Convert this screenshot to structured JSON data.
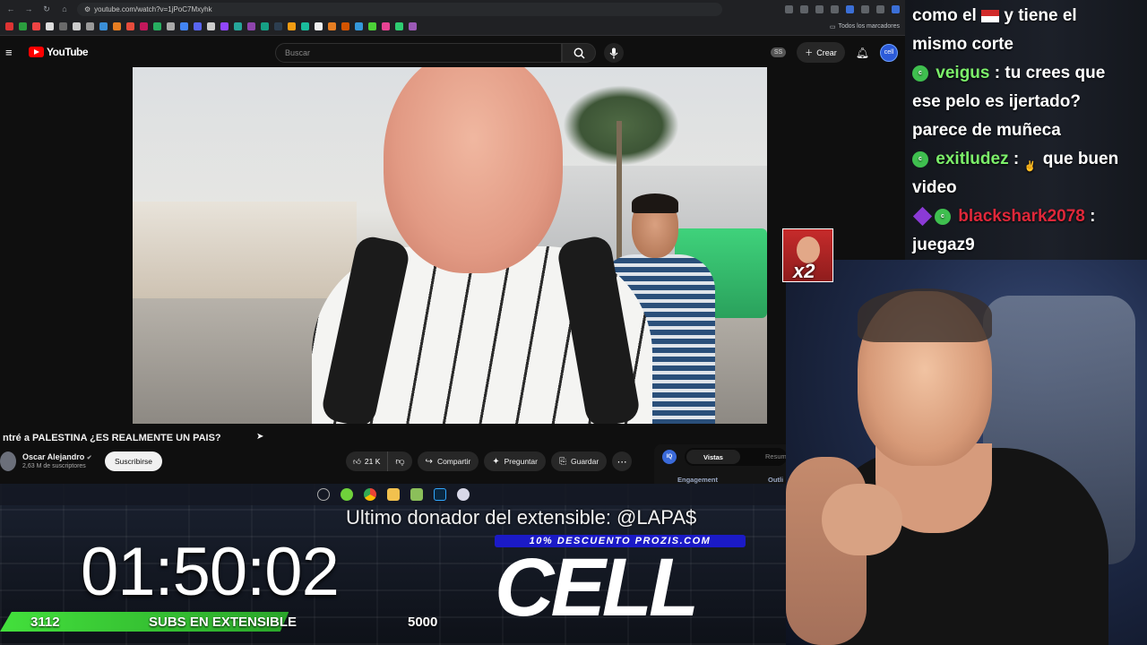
{
  "browser": {
    "url": "youtube.com/watch?v=1jPoC7Mxyhk",
    "bookmarks_folder": "Todos los marcadores"
  },
  "youtube": {
    "logo_text": "YouTube",
    "search_placeholder": "Buscar",
    "ss_badge": "SS",
    "create_label": "Crear",
    "avatar_text": "cell"
  },
  "video": {
    "title": "ntré a PALESTINA ¿ES REALMENTE UN PAIS?",
    "channel_name": "Oscar Alejandro",
    "channel_subs": "2,63 M de suscriptores",
    "subscribe_label": "Suscribirse",
    "likes": "21 K",
    "share_label": "Compartir",
    "ask_label": "Preguntar",
    "save_label": "Guardar"
  },
  "side_panel": {
    "badge": "IQ",
    "tab_active": "Vistas",
    "tab_other": "Resum",
    "label_1": "Engagement",
    "label_2": "Outli"
  },
  "overlay": {
    "donor_text": "Ultimo donador del extensible: @LAPA$",
    "promo_text": "10% DESCUENTO PROZIS.COM",
    "brand": "CELL",
    "timer": "01:50:02",
    "subgoal_current": "3112",
    "subgoal_label": "SUBS EN EXTENSIBLE",
    "subgoal_max": "5000",
    "subgoal_progress": 0.62,
    "mini_cam_multiplier": "x2"
  },
  "chat": {
    "line1_a": "como el",
    "line1_b": "y tiene el",
    "line2": "mismo corte",
    "m1_user": "veigus",
    "m1_text": ": tu crees que",
    "m1_cont1": "ese pelo es ijertado?",
    "m1_cont2": "parece de muñeca",
    "m2_user": "exitludez",
    "m2_colon": ":",
    "m2_text": "que buen",
    "m2_cont": "video",
    "m3_user": "blackshark2078",
    "m3_colon": ":",
    "m3_cont": "juegaz9"
  },
  "colors": {
    "youtube_red": "#ff0000",
    "chat_user_green": "#7cf06a",
    "chat_user_red": "#e0283a",
    "goal_green": "#43e03c",
    "promo_blue": "#1b1ac7"
  }
}
